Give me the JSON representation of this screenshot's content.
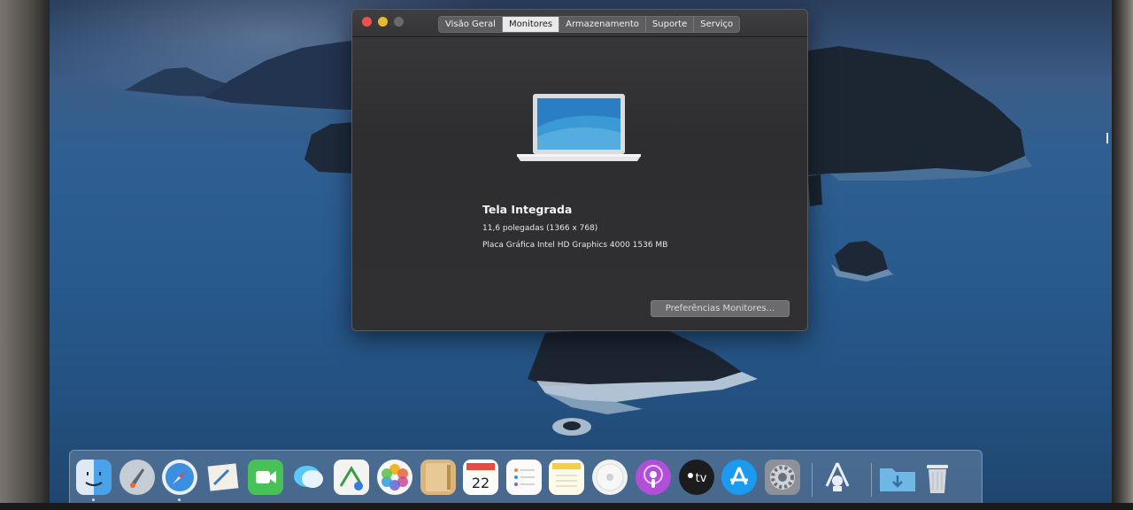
{
  "window": {
    "tabs": [
      "Visão Geral",
      "Monitores",
      "Armazenamento",
      "Suporte",
      "Serviço"
    ],
    "active_tab": "Monitores"
  },
  "display": {
    "name": "Tela Integrada",
    "size": "11,6 polegadas (1366 x 768)",
    "graphics": "Placa Gráfica Intel HD Graphics 4000 1536 MB"
  },
  "prefs_button": "Preferências Monitores...",
  "dock": {
    "apps": [
      {
        "name": "finder-icon",
        "running": true
      },
      {
        "name": "launchpad-icon",
        "running": false
      },
      {
        "name": "safari-icon",
        "running": true
      },
      {
        "name": "mail-icon",
        "running": false
      },
      {
        "name": "facetime-icon",
        "running": false
      },
      {
        "name": "messages-icon",
        "running": false
      },
      {
        "name": "maps-icon",
        "running": false
      },
      {
        "name": "photos-icon",
        "running": false
      },
      {
        "name": "contacts-icon",
        "running": false
      },
      {
        "name": "calendar-icon",
        "running": false
      },
      {
        "name": "reminders-icon",
        "running": false
      },
      {
        "name": "notes-icon",
        "running": false
      },
      {
        "name": "music-icon",
        "running": false
      },
      {
        "name": "podcasts-icon",
        "running": false
      },
      {
        "name": "apple-tv-icon",
        "running": false
      },
      {
        "name": "app-store-icon",
        "running": false
      },
      {
        "name": "system-preferences-icon",
        "running": false
      },
      {
        "name": "utility-tool-icon",
        "running": false
      },
      {
        "name": "downloads-folder-icon",
        "running": false
      },
      {
        "name": "trash-icon",
        "running": false
      }
    ],
    "tv_label": "tv"
  },
  "colors": {
    "close": "#f0504a",
    "minimize": "#e8b82f",
    "window_bg": "#303032",
    "desktop_sea": "#285a8e"
  }
}
